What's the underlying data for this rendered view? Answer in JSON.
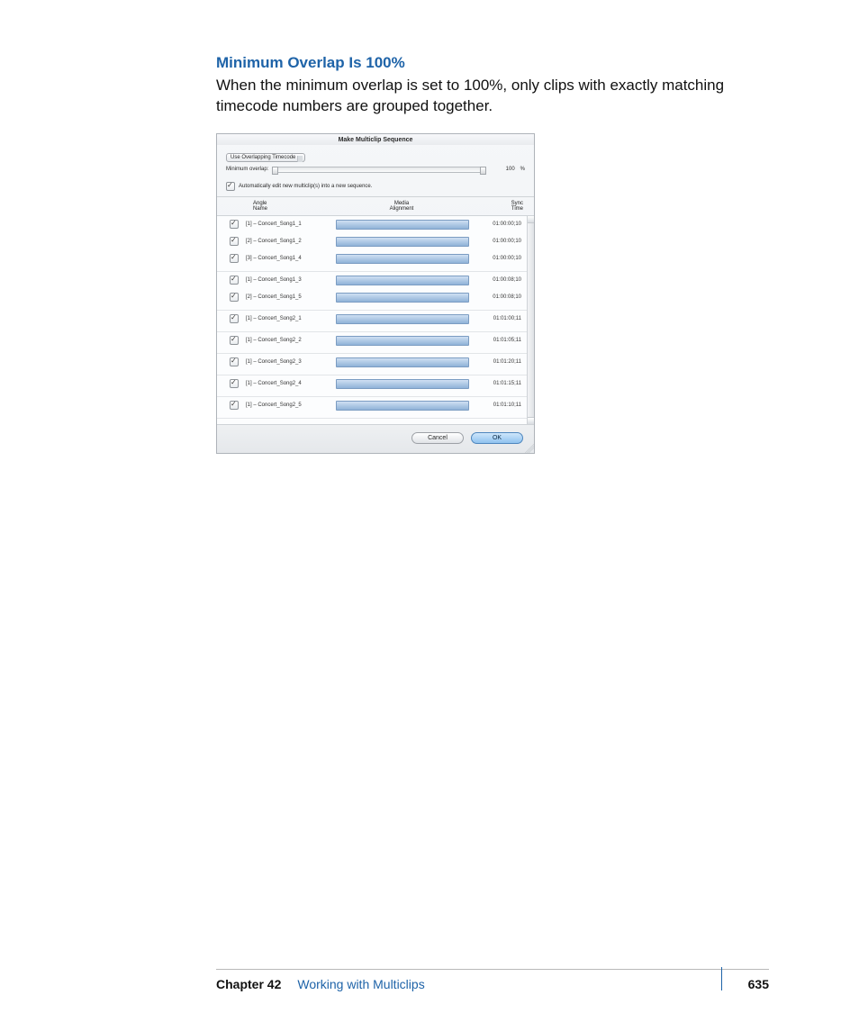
{
  "heading": "Minimum Overlap Is 100%",
  "paragraph": "When the minimum overlap is set to 100%, only clips with exactly matching timecode numbers are grouped together.",
  "dialog": {
    "title": "Make Multiclip Sequence",
    "sync_mode": "Use Overlapping Timecode",
    "overlap_label": "Minimum overlap:",
    "overlap_value": "100",
    "overlap_unit": "%",
    "auto_edit_label": "Automatically edit new multiclip(s) into a new sequence.",
    "columns": {
      "angle_l1": "Angle",
      "angle_l2": "Name",
      "media_l1": "Media",
      "media_l2": "Alignment",
      "sync_l1": "Sync",
      "sync_l2": "Time"
    },
    "groups": [
      {
        "rows": [
          {
            "angle": "[1] – Concert_Song1_1",
            "sync": "01:00:00;10"
          },
          {
            "angle": "[2] – Concert_Song1_2",
            "sync": "01:00:00;10"
          },
          {
            "angle": "[3] – Concert_Song1_4",
            "sync": "01:00:00;10"
          }
        ]
      },
      {
        "rows": [
          {
            "angle": "[1] – Concert_Song1_3",
            "sync": "01:00:08;10"
          },
          {
            "angle": "[2] – Concert_Song1_5",
            "sync": "01:00:08;10"
          }
        ]
      },
      {
        "rows": [
          {
            "angle": "[1] – Concert_Song2_1",
            "sync": "01:01:00;11"
          }
        ]
      },
      {
        "rows": [
          {
            "angle": "[1] – Concert_Song2_2",
            "sync": "01:01:05;11"
          }
        ]
      },
      {
        "rows": [
          {
            "angle": "[1] – Concert_Song2_3",
            "sync": "01:01:20;11"
          }
        ]
      },
      {
        "rows": [
          {
            "angle": "[1] – Concert_Song2_4",
            "sync": "01:01:15;11"
          }
        ]
      },
      {
        "rows": [
          {
            "angle": "[1] – Concert_Song2_5",
            "sync": "01:01:10;11"
          }
        ]
      }
    ],
    "buttons": {
      "cancel": "Cancel",
      "ok": "OK"
    }
  },
  "footer": {
    "chapter_label": "Chapter 42",
    "chapter_title": "Working with Multiclips",
    "page_number": "635"
  }
}
